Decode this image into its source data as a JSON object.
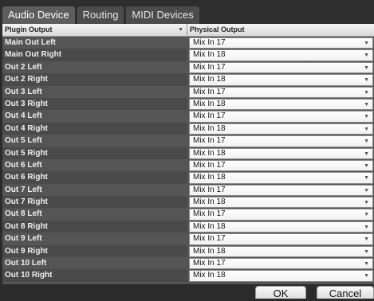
{
  "tabs": [
    {
      "label": "Audio Device"
    },
    {
      "label": "Routing"
    },
    {
      "label": "MIDI Devices"
    }
  ],
  "table": {
    "col1": "Plugin Output",
    "col2": "Physical Output",
    "rows": [
      {
        "output": "Main Out Left",
        "physical": "Mix In 17"
      },
      {
        "output": "Main Out Right",
        "physical": "Mix In 18"
      },
      {
        "output": "Out 2 Left",
        "physical": "Mix In 17"
      },
      {
        "output": "Out 2 Right",
        "physical": "Mix In 18"
      },
      {
        "output": "Out 3 Left",
        "physical": "Mix In 17"
      },
      {
        "output": "Out 3 Right",
        "physical": "Mix In 18"
      },
      {
        "output": "Out 4 Left",
        "physical": "Mix In 17"
      },
      {
        "output": "Out 4 Right",
        "physical": "Mix In 18"
      },
      {
        "output": "Out 5 Left",
        "physical": "Mix In 17"
      },
      {
        "output": "Out 5 Right",
        "physical": "Mix In 18"
      },
      {
        "output": "Out 6 Left",
        "physical": "Mix In 17"
      },
      {
        "output": "Out 6 Right",
        "physical": "Mix In 18"
      },
      {
        "output": "Out 7 Left",
        "physical": "Mix In 17"
      },
      {
        "output": "Out 7 Right",
        "physical": "Mix In 18"
      },
      {
        "output": "Out 8 Left",
        "physical": "Mix In 17"
      },
      {
        "output": "Out 8 Right",
        "physical": "Mix In 18"
      },
      {
        "output": "Out 9 Left",
        "physical": "Mix In 17"
      },
      {
        "output": "Out 9 Right",
        "physical": "Mix In 18"
      },
      {
        "output": "Out 10 Left",
        "physical": "Mix In 17"
      },
      {
        "output": "Out 10 Right",
        "physical": "Mix In 18"
      }
    ]
  },
  "buttons": {
    "ok": "OK",
    "cancel": "Cancel"
  },
  "icons": {
    "sort": "sort-down-icon",
    "dropdown": "chevron-down-icon"
  },
  "colors": {
    "background": "#2b2b2b",
    "row": "#555555",
    "active_tab": "#5d5d5d"
  }
}
